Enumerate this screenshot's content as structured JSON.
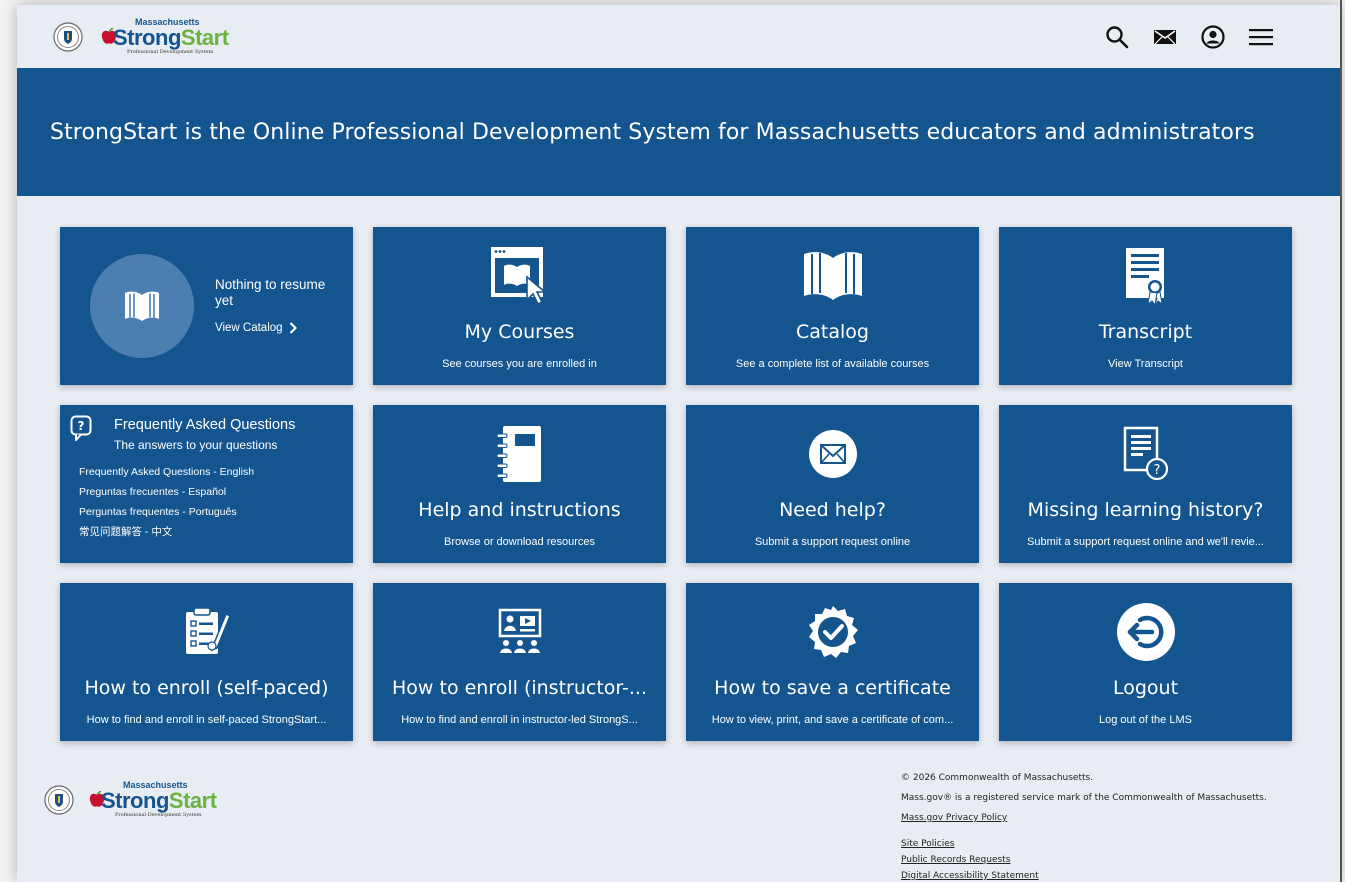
{
  "brand": {
    "small": "Massachusetts",
    "strong": "Strong",
    "start": "Start",
    "tagline": "Professional Development System"
  },
  "header_icons": [
    "search-icon",
    "mail-icon",
    "account-icon",
    "menu-icon"
  ],
  "hero": {
    "title": "StrongStart is the Online Professional Development System for Massachusetts educators and administrators"
  },
  "tiles": {
    "resume": {
      "text": "Nothing to resume yet",
      "link": "View Catalog"
    },
    "my_courses": {
      "title": "My Courses",
      "sub": "See courses you are enrolled in"
    },
    "catalog": {
      "title": "Catalog",
      "sub": "See a complete list of available courses"
    },
    "transcript": {
      "title": "Transcript",
      "sub": "View Transcript"
    },
    "faq": {
      "title": "Frequently Asked Questions",
      "sub": "The answers to your questions",
      "links": [
        "Frequently Asked Questions - English",
        "Preguntas frecuentes - Español",
        "Perguntas frequentes - Português",
        "常见问题解答 - 中文"
      ]
    },
    "help": {
      "title": "Help and instructions",
      "sub": "Browse or download resources"
    },
    "need_help": {
      "title": "Need help?",
      "sub": "Submit a support request online"
    },
    "missing": {
      "title": "Missing learning history?",
      "sub": "Submit a support request online and we'll revie..."
    },
    "enroll_self": {
      "title": "How to enroll (self-paced)",
      "sub": "How to find and enroll in self-paced StrongStart..."
    },
    "enroll_instructor": {
      "title": "How to enroll (instructor-...",
      "sub": "How to find and enroll in instructor-led StrongS..."
    },
    "certificate": {
      "title": "How to save a certificate",
      "sub": "How to view, print, and save a certificate of com..."
    },
    "logout": {
      "title": "Logout",
      "sub": "Log out of the LMS"
    }
  },
  "footer": {
    "copyright": "© 2026 Commonwealth of Massachusetts.",
    "trademark": "Mass.gov® is a registered service mark of the Commonwealth of Massachusetts.",
    "privacy": "Mass.gov Privacy Policy",
    "links": [
      "Site Policies",
      "Public Records Requests",
      "Digital Accessibility Statement"
    ]
  },
  "colors": {
    "primary": "#14558f",
    "accent_green": "#6cb33f",
    "apple_red": "#c8102e",
    "background": "#e8edf3"
  }
}
